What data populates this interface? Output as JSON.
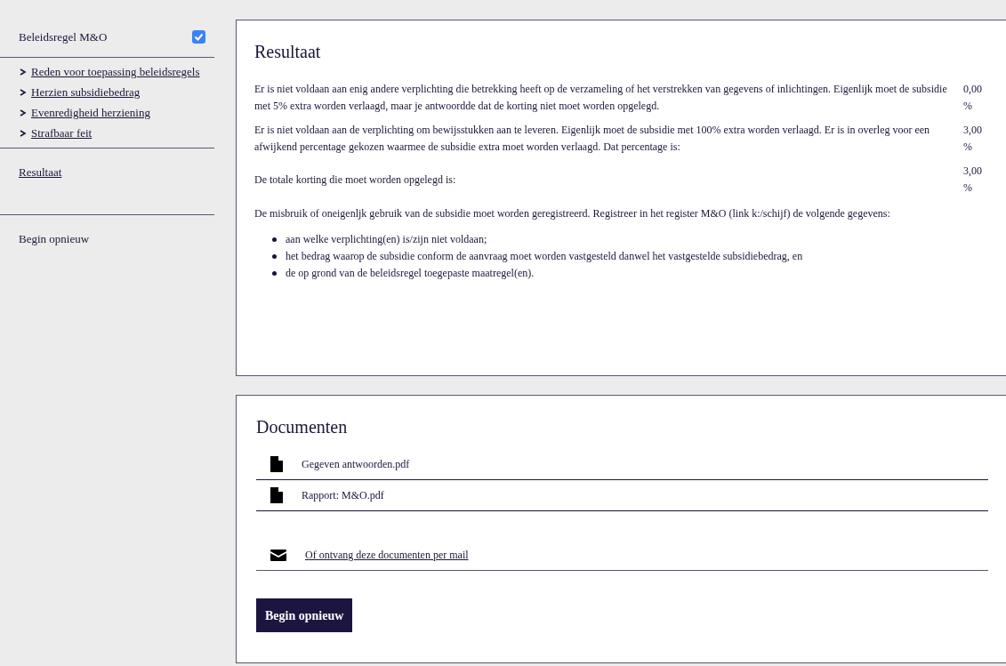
{
  "sidebar": {
    "header": {
      "label": "Beleidsregel M&O",
      "checked": true
    },
    "steps": [
      {
        "label": "Reden voor toepassing beleidsregels"
      },
      {
        "label": "Herzien subsidiebedrag"
      },
      {
        "label": "Evenredigheid herziening"
      },
      {
        "label": "Strafbaar feit"
      }
    ],
    "result_link": "Resultaat",
    "restart": "Begin opnieuw"
  },
  "result": {
    "title": "Resultaat",
    "rows": [
      {
        "text": "Er is niet voldaan aan enig andere verplichting die betrekking heeft op de verzameling of het verstrekken van gegevens of inlichtingen. Eigenlijk moet de subsidie met 5% extra worden verlaagd, maar je antwoordde dat de korting niet moet worden opgelegd.",
        "value": "0,00 %"
      },
      {
        "text": "Er is niet voldaan aan de verplichting om bewijsstukken aan te leveren. Eigenlijk moet de subsidie met 100% extra worden verlaagd. Er is in overleg voor een afwijkend percentage gekozen waarmee de subsidie extra moet worden verlaagd. Dat percentage is:",
        "value": "3,00 %"
      },
      {
        "text": "De totale korting die moet worden opgelegd is:",
        "value": "3,00 %"
      }
    ],
    "note": "De misbruik of oneigenljk gebruik van de subsidie moet worden geregistreerd. Registreer in het register M&O (link k:/schijf) de volgende gegevens:",
    "bullets": [
      "aan welke verplichting(en) is/zijn niet voldaan;",
      "het bedrag waarop de subsidie conform de aanvraag moet worden vastgesteld danwel het vastgestelde subsidiebedrag, en",
      "de op grond van de beleidsregel toegepaste maatregel(en)."
    ]
  },
  "documents": {
    "title": "Documenten",
    "files": [
      {
        "name": "Gegeven antwoorden.pdf"
      },
      {
        "name": "Rapport: M&O.pdf"
      }
    ],
    "mail_link": "Of ontvang deze documenten per mail",
    "button": "Begin opnieuw"
  }
}
